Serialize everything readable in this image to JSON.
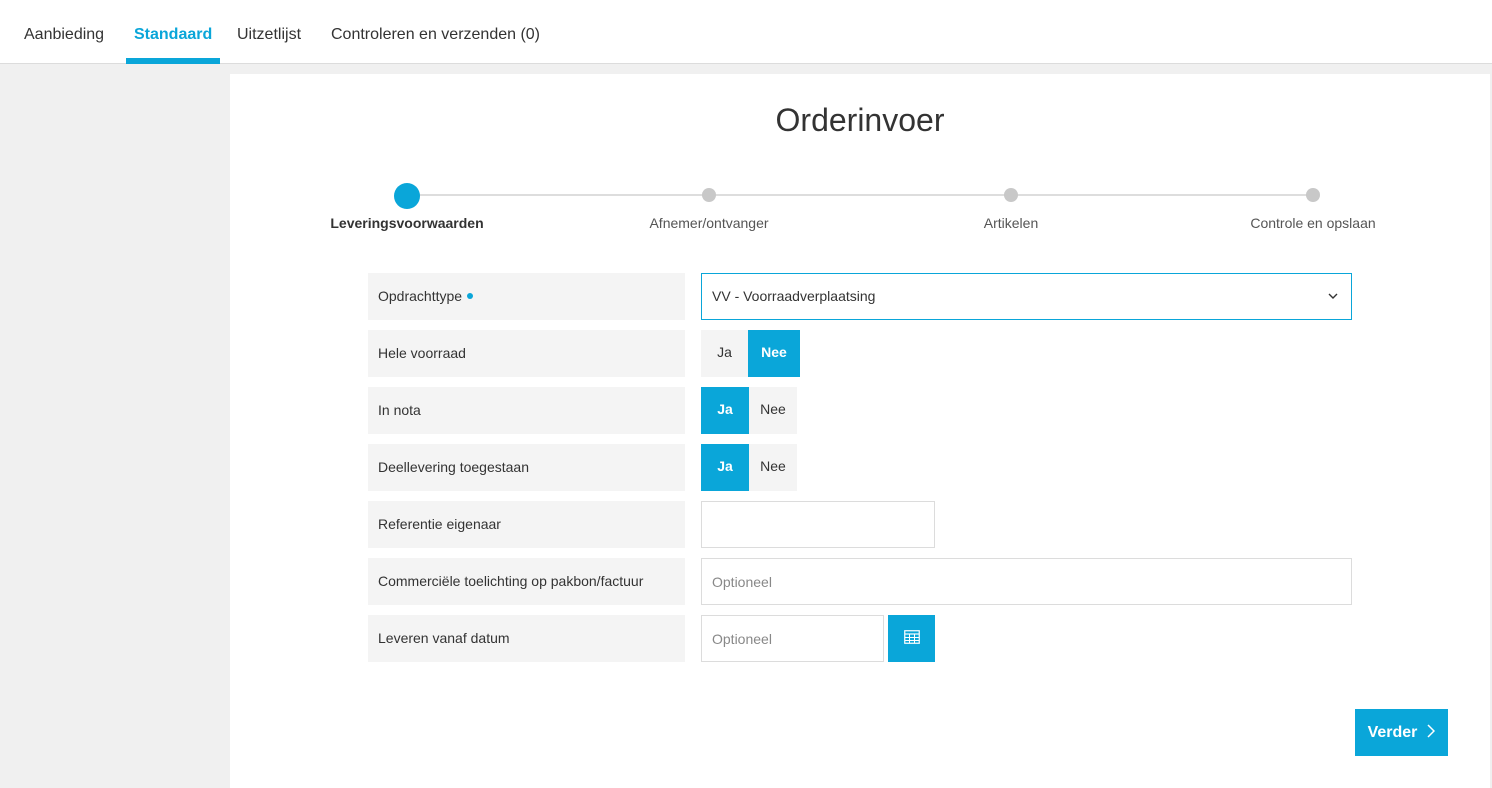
{
  "tabs": [
    {
      "label": "Aanbieding",
      "active": false
    },
    {
      "label": "Standaard",
      "active": true
    },
    {
      "label": "Uitzetlijst",
      "active": false
    },
    {
      "label": "Controleren en verzenden (0)",
      "active": false
    }
  ],
  "page": {
    "title": "Orderinvoer"
  },
  "steps": [
    {
      "label": "Leveringsvoorwaarden",
      "active": true
    },
    {
      "label": "Afnemer/ontvanger",
      "active": false
    },
    {
      "label": "Artikelen",
      "active": false
    },
    {
      "label": "Controle en opslaan",
      "active": false
    }
  ],
  "form": {
    "opdrachttype": {
      "label": "Opdrachttype",
      "value": "VV - Voorraadverplaatsing",
      "required": true
    },
    "hele_voorraad": {
      "label": "Hele voorraad",
      "yes": "Ja",
      "no": "Nee",
      "selected": "Nee"
    },
    "in_nota": {
      "label": "In nota",
      "yes": "Ja",
      "no": "Nee",
      "selected": "Ja"
    },
    "deellevering": {
      "label": "Deellevering toegestaan",
      "yes": "Ja",
      "no": "Nee",
      "selected": "Ja"
    },
    "referentie": {
      "label": "Referentie eigenaar",
      "value": ""
    },
    "toelichting": {
      "label": "Commerciële toelichting op pakbon/factuur",
      "placeholder": "Optioneel",
      "value": ""
    },
    "leverdatum": {
      "label": "Leveren vanaf datum",
      "placeholder": "Optioneel",
      "value": ""
    }
  },
  "actions": {
    "next_label": "Verder"
  },
  "colors": {
    "accent": "#0aa6d9",
    "label_bg": "#f4f4f4",
    "page_bg": "#f0f0f0"
  }
}
